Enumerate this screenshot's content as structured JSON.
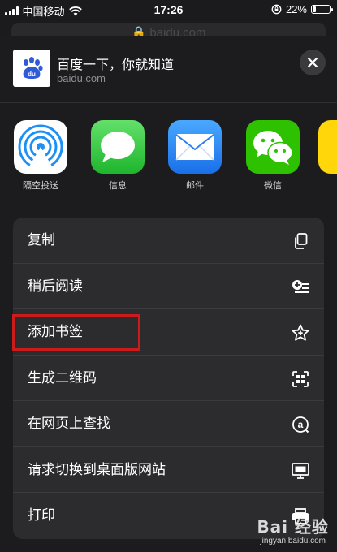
{
  "status_bar": {
    "carrier": "中国移动",
    "time": "17:26",
    "battery": "22%",
    "battery_level": 0.22
  },
  "backdrop": {
    "url": "baidu.com"
  },
  "header": {
    "title": "百度一下，你就知道",
    "domain": "baidu.com"
  },
  "apps": [
    {
      "label": "隔空投送",
      "icon": "airdrop-icon"
    },
    {
      "label": "信息",
      "icon": "messages-icon"
    },
    {
      "label": "邮件",
      "icon": "mail-icon"
    },
    {
      "label": "微信",
      "icon": "wechat-icon"
    }
  ],
  "actions": [
    {
      "label": "复制",
      "icon": "copy-icon"
    },
    {
      "label": "稍后阅读",
      "icon": "reading-list-icon"
    },
    {
      "label": "添加书签",
      "icon": "star-icon"
    },
    {
      "label": "生成二维码",
      "icon": "qr-code-icon"
    },
    {
      "label": "在网页上查找",
      "icon": "find-icon"
    },
    {
      "label": "请求切换到桌面版网站",
      "icon": "desktop-icon"
    },
    {
      "label": "打印",
      "icon": "print-icon"
    }
  ],
  "watermark": {
    "brand": "Bai 经验",
    "url": "jingyan.baidu.com"
  },
  "colors": {
    "highlight": "#cc1b1b",
    "sheet_bg": "#1c1c1e",
    "group_bg": "#2c2c2e"
  }
}
